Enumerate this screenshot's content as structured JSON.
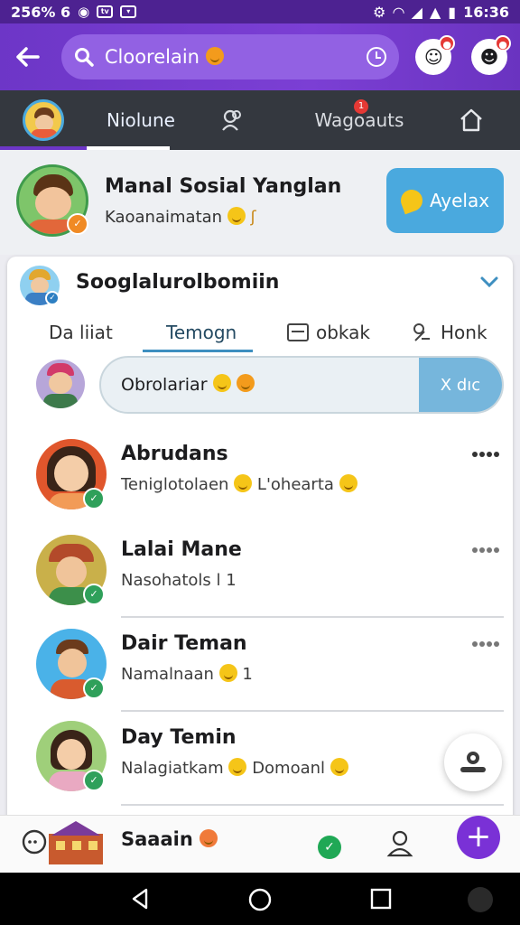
{
  "status_bar": {
    "left_text": "256% 6",
    "time": "16:36"
  },
  "app_bar": {
    "search_text": "Cloorelain",
    "badge_1": "●",
    "badge_2": "●"
  },
  "tabs": [
    {
      "label": "Niolune",
      "icon": "globe-icon",
      "active": true
    },
    {
      "label": "",
      "icon": "people-icon",
      "active": false
    },
    {
      "label": "Wagoauts",
      "icon": "bell-icon",
      "active": false,
      "badge": "1"
    },
    {
      "label": "",
      "icon": "home-icon",
      "active": false
    }
  ],
  "profile": {
    "name": "Manal Sosial Yanglan",
    "subtitle": "Kaoanaimatan",
    "action_label": "Ayelax"
  },
  "card": {
    "title": "Sooglalurolbomiin",
    "filters": [
      {
        "label": "Da liiat",
        "icon": ""
      },
      {
        "label": "Temogn",
        "icon": ""
      },
      {
        "label": "obkak",
        "icon": "list-icon"
      },
      {
        "label": "Honk",
        "icon": "link-icon"
      }
    ],
    "compose_text": "Obrolariar",
    "compose_send": "X dıc"
  },
  "contacts": [
    {
      "name": "Abrudans",
      "message": "Teniglotolaen",
      "message_2": "L'ohearta"
    },
    {
      "name": "Lalai Mane",
      "message": "Nasohatols  l 1",
      "message_2": ""
    },
    {
      "name": "Dair Teman",
      "message": "Namalnaan",
      "message_2": "1"
    },
    {
      "name": "Day Temin",
      "message": "Nalagiatkam",
      "message_2": "Domoanl"
    }
  ],
  "bottom_bar": {
    "name": "Saaain"
  },
  "colors": {
    "primary": "#6d36c7",
    "status_bar": "#4d2291",
    "tab_bar": "#34383f",
    "accent_blue": "#4aa9de",
    "check_green": "#2fa05a",
    "check_orange": "#f08a24"
  }
}
